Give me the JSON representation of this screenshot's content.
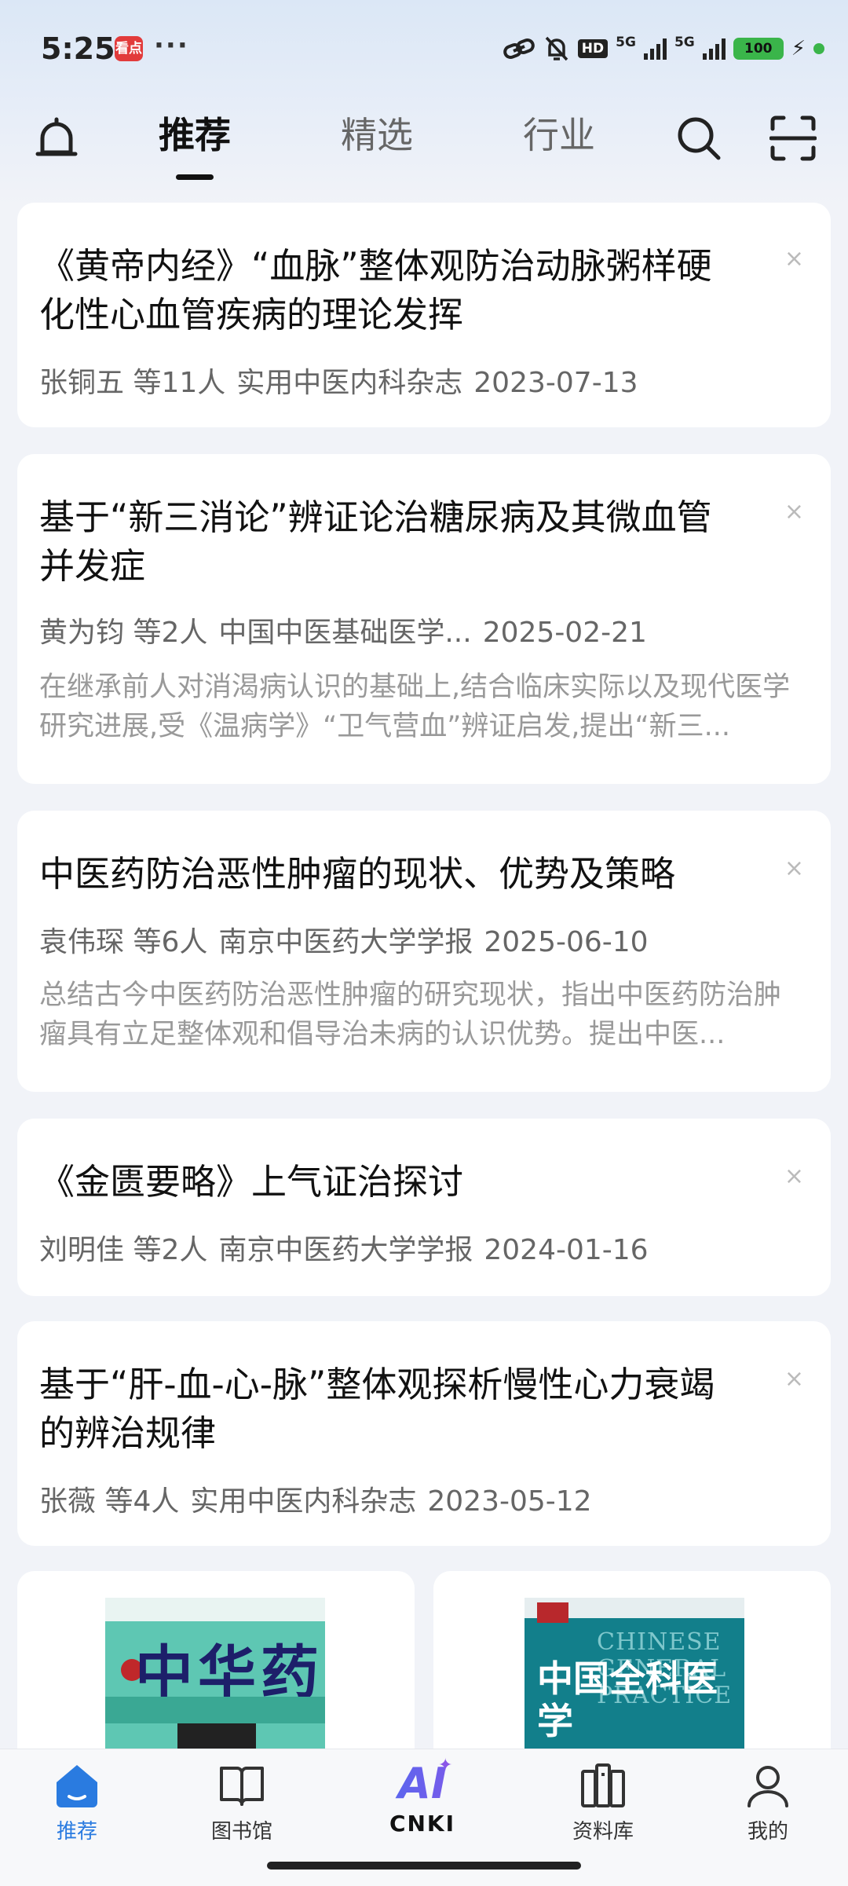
{
  "status_bar": {
    "time": "5:25",
    "app_badge": "看点",
    "more": "···",
    "hd": "HD",
    "net1": "5G",
    "net2": "5G",
    "battery": "100"
  },
  "header": {
    "tabs": [
      {
        "label": "推荐",
        "active": true
      },
      {
        "label": "精选",
        "active": false
      },
      {
        "label": "行业",
        "active": false
      }
    ]
  },
  "feed": [
    {
      "title": "《黄帝内经》“血脉”整体观防治动脉粥样硬化性心血管疾病的理论发挥",
      "authors": "张铜五 等11人",
      "journal": "实用中医内科杂志",
      "date": "2023-07-13",
      "abstract": ""
    },
    {
      "title": "基于“新三消论”辨证论治糖尿病及其微血管并发症",
      "authors": "黄为钧 等2人",
      "journal": "中国中医基础医学...",
      "date": "2025-02-21",
      "abstract": "在继承前人对消渴病认识的基础上,结合临床实际以及现代医学研究进展,受《温病学》“卫气营血”辨证启发,提出“新三..."
    },
    {
      "title": "中医药防治恶性肿瘤的现状、优势及策略",
      "authors": "袁伟琛 等6人",
      "journal": "南京中医药大学学报",
      "date": "2025-06-10",
      "abstract": "总结古今中医药防治恶性肿瘤的研究现状，指出中医药防治肿瘤具有立足整体观和倡导治未病的认识优势。提出中医..."
    },
    {
      "title": "《金匮要略》上气证治探讨",
      "authors": "刘明佳 等2人",
      "journal": "南京中医药大学学报",
      "date": "2024-01-16",
      "abstract": ""
    },
    {
      "title": "基于“肝-血-心-脉”整体观探析慢性心力衰竭的辨治规律",
      "authors": "张薇 等4人",
      "journal": "实用中医内科杂志",
      "date": "2023-05-12",
      "abstract": ""
    }
  ],
  "close_glyph": "×",
  "journals": [
    {
      "cover_title": "中华药",
      "colors": {
        "bg": "#5ec7b3"
      }
    },
    {
      "cover_en": "CHINESE GENERAL PRACTICE",
      "cover_cn": "中国全科医学",
      "colors": {
        "bg": "#127f8b"
      }
    }
  ],
  "bottom_nav": {
    "items": [
      {
        "label": "推荐",
        "icon": "home-icon",
        "active": true
      },
      {
        "label": "图书馆",
        "icon": "book-icon",
        "active": false
      },
      {
        "label": "CNKI",
        "icon": "ai-icon",
        "ai_text": "AI",
        "active": false
      },
      {
        "label": "资料库",
        "icon": "library-icon",
        "active": false
      },
      {
        "label": "我的",
        "icon": "user-icon",
        "active": false
      }
    ]
  },
  "colors": {
    "accent": "#2a7be0",
    "ai_gradient_start": "#4a6cf0",
    "ai_gradient_end": "#8a55e8"
  }
}
